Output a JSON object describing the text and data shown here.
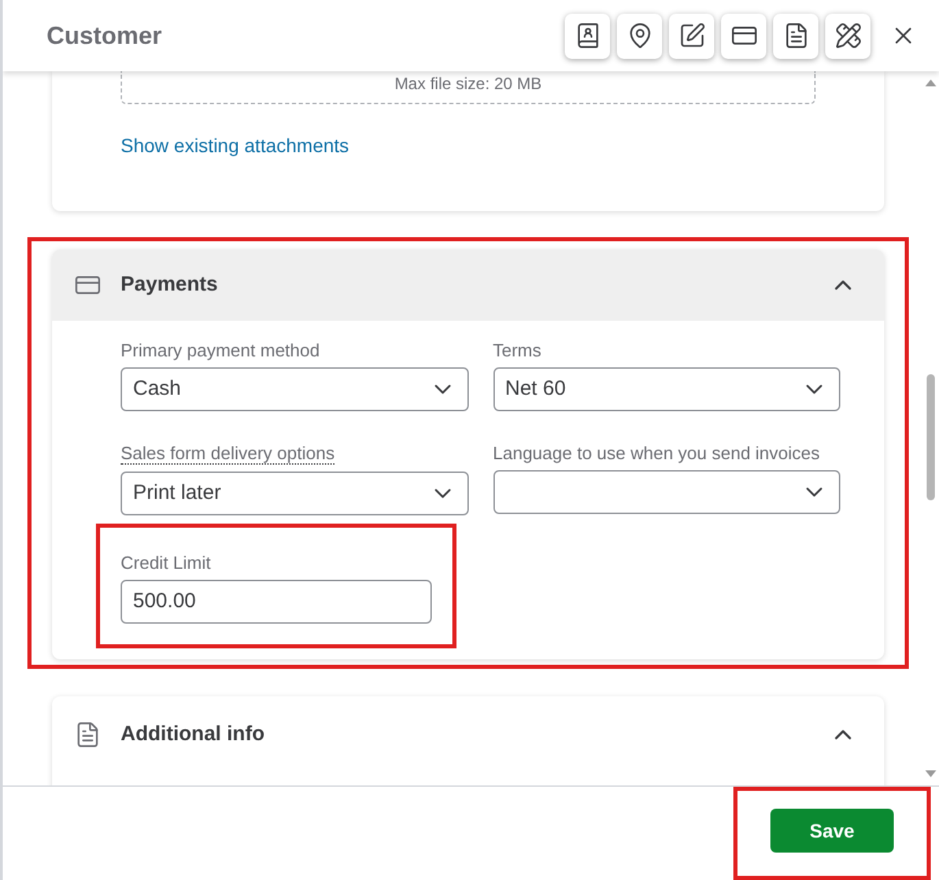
{
  "header": {
    "title": "Customer"
  },
  "attachments": {
    "max_size_text": "Max file size: 20 MB",
    "link": "Show existing attachments"
  },
  "payments": {
    "title": "Payments",
    "expanded": true,
    "highlighted": true,
    "fields": [
      {
        "label": "Primary payment method",
        "value": "Cash",
        "dotted_label": false
      },
      {
        "label": "Terms",
        "value": "Net 60",
        "dotted_label": false
      },
      {
        "label": "Sales form delivery options",
        "value": "Print later",
        "dotted_label": true
      },
      {
        "label": "Language to use when you send invoices",
        "dotted_label": false
      }
    ],
    "credit_limit": {
      "label": "Credit Limit",
      "value": "500.00",
      "highlighted": true
    }
  },
  "additional_info": {
    "title": "Additional info",
    "expanded": true
  },
  "footer": {
    "save": "Save",
    "highlighted": true
  }
}
